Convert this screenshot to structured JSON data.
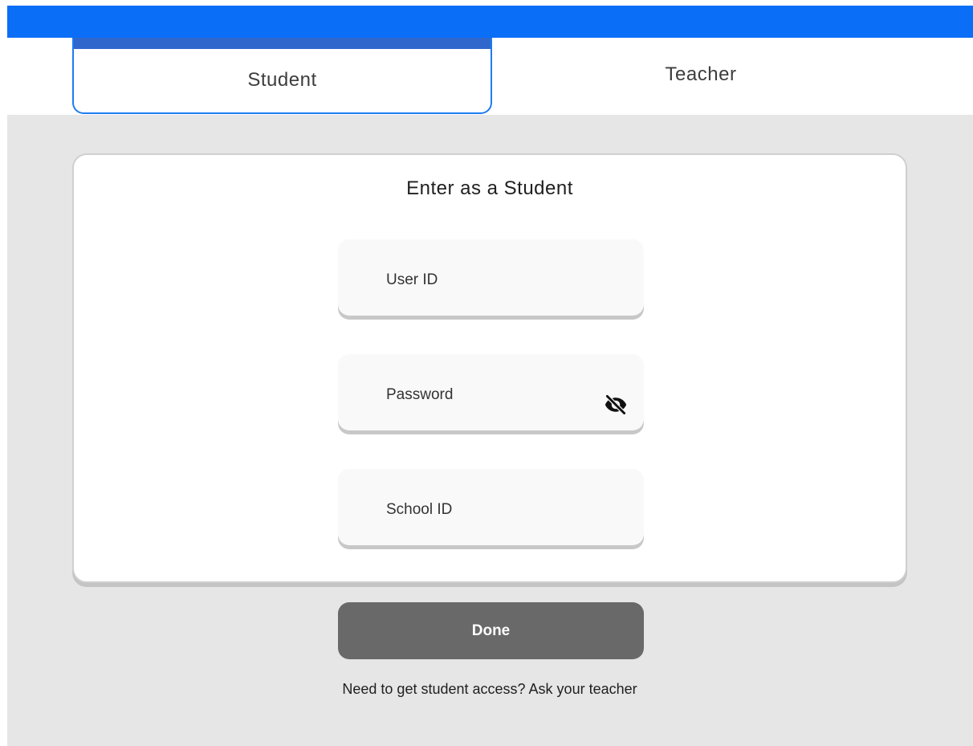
{
  "tabs": [
    {
      "label": "Student",
      "selected": true
    },
    {
      "label": "Teacher",
      "selected": false
    }
  ],
  "form": {
    "title": "Enter as a Student",
    "fields": {
      "user_id": {
        "placeholder": "User ID",
        "value": ""
      },
      "password": {
        "placeholder": "Password",
        "value": "",
        "visibility_icon": "eye-off-icon"
      },
      "school_id": {
        "placeholder": "School ID",
        "value": ""
      }
    },
    "done_label": "Done",
    "help_text": "Need to get student access? Ask your teacher"
  },
  "colors": {
    "topbar": "#0a6ef7",
    "tab_active_border": "#1e7cf2",
    "tab_active_indicator": "#3067cc",
    "background": "#e6e6e6",
    "done_button": "#696969"
  }
}
